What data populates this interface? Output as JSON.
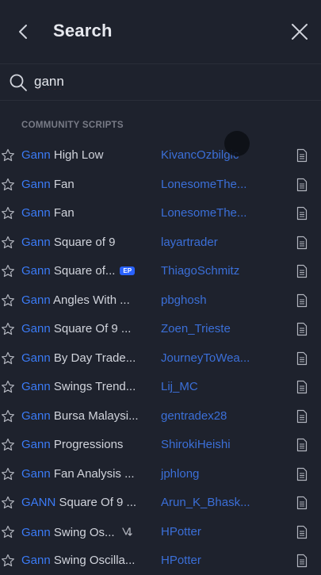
{
  "header": {
    "title": "Search"
  },
  "search": {
    "value": "gann"
  },
  "section": {
    "label": "COMMUNITY SCRIPTS"
  },
  "colors": {
    "background": "#1e222d",
    "highlight": "#3b7bf6",
    "author": "#3b6fd8",
    "badge": "#2962ff"
  },
  "results": [
    {
      "prefix": "Gann",
      "name": " High Low",
      "badge": "",
      "strategy": false,
      "author": "KivancOzbilgic"
    },
    {
      "prefix": "Gann",
      "name": " Fan",
      "badge": "",
      "strategy": false,
      "author": "LonesomeThe..."
    },
    {
      "prefix": "Gann",
      "name": " Fan",
      "badge": "",
      "strategy": false,
      "author": "LonesomeThe..."
    },
    {
      "prefix": "Gann",
      "name": " Square of 9",
      "badge": "",
      "strategy": false,
      "author": "layartrader"
    },
    {
      "prefix": "Gann",
      "name": " Square of...",
      "badge": "EP",
      "strategy": false,
      "author": "ThiagoSchmitz"
    },
    {
      "prefix": "Gann",
      "name": " Angles With ...",
      "badge": "",
      "strategy": false,
      "author": "pbghosh"
    },
    {
      "prefix": "Gann",
      "name": " Square Of 9 ...",
      "badge": "",
      "strategy": false,
      "author": "Zoen_Trieste"
    },
    {
      "prefix": "Gann",
      "name": " By Day Trade...",
      "badge": "",
      "strategy": false,
      "author": "JourneyToWea..."
    },
    {
      "prefix": "Gann",
      "name": " Swings Trend...",
      "badge": "",
      "strategy": false,
      "author": "Lij_MC"
    },
    {
      "prefix": "Gann",
      "name": " Bursa Malaysi...",
      "badge": "",
      "strategy": false,
      "author": "gentradex28"
    },
    {
      "prefix": "Gann",
      "name": " Progressions",
      "badge": "",
      "strategy": false,
      "author": "ShirokiHeishi"
    },
    {
      "prefix": "Gann",
      "name": " Fan Analysis ...",
      "badge": "",
      "strategy": false,
      "author": "jphlong"
    },
    {
      "prefix": "GANN",
      "name": " Square Of 9 ...",
      "badge": "",
      "strategy": false,
      "author": "Arun_K_Bhask..."
    },
    {
      "prefix": "Gann",
      "name": " Swing Os...",
      "badge": "",
      "strategy": true,
      "author": "HPotter"
    },
    {
      "prefix": "Gann",
      "name": " Swing Oscilla...",
      "badge": "",
      "strategy": false,
      "author": "HPotter"
    }
  ]
}
